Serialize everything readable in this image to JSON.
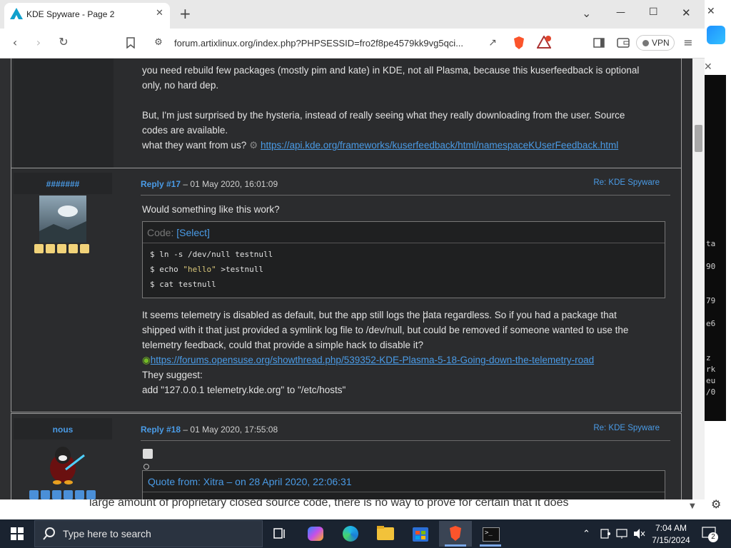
{
  "browser": {
    "tab_title": "KDE Spyware - Page 2",
    "new_tab": "+",
    "url": "forum.artixlinux.org/index.php?PHPSESSID=fro2f8pe4579kk9vg5qci...",
    "vpn_label": "VPN",
    "window_controls": {
      "dropdown": "⌄",
      "minimize": "—",
      "maximize": "☐",
      "close": "✕"
    }
  },
  "prev_post": {
    "line1": "you need rebuild few packages (mostly pim and kate) in KDE, not all Plasma, because this kuserfeedback is optional",
    "line2": "only, no hard dep.",
    "line3": "But, I'm just surprised by the hysteria, instead of really seeing what they really downloading from the user. Source",
    "line4": "codes are available.",
    "line5_prefix": "what they want from us?",
    "line5_link": "https://api.kde.org/frameworks/kuserfeedback/html/namespaceKUserFeedback.html"
  },
  "post17": {
    "username": "#######",
    "reply_label": "Reply #17",
    "reply_date": " – 01 May 2020, 16:01:09",
    "re_link": "Re: KDE Spyware",
    "intro": "Would something like this work?",
    "code_label": "Code:",
    "code_select": "[Select]",
    "code_lines": [
      {
        "pre": "$ ln -s /dev/null testnull",
        "str": "",
        "post": ""
      },
      {
        "pre": "$ echo ",
        "str": "\"hello\"",
        "post": " >testnull"
      },
      {
        "pre": "$ cat testnull",
        "str": "",
        "post": ""
      }
    ],
    "body1": "It seems telemetry is disabled as default, but the app still logs the data regardless. So if you had a package that",
    "body2": "shipped with it that just provided a symlink log file to /dev/null, but could be removed if someone wanted to use the",
    "body3": "telemetry feedback, could that provide a simple hack to disable it?",
    "link": "https://forums.opensuse.org/showthread.php/539352-KDE-Plasma-5-18-Going-down-the-telemetry-road",
    "body4": "They suggest:",
    "body5": "add \"127.0.0.1 telemetry.kde.org\" to \"/etc/hosts\""
  },
  "post18": {
    "username": "nous",
    "reply_label": "Reply #18",
    "reply_date": " – 01 May 2020, 17:55:08",
    "re_link": "Re: KDE Spyware",
    "quote_header": "Quote from: Xitra – on 28 April 2020, 22:06:31",
    "stub": "re"
  },
  "background_text": "large amount of proprietary closed source code, there is no way to prove for certain that it does",
  "taskbar": {
    "search_placeholder": "Type here to search",
    "time": "7:04 AM",
    "date": "7/15/2024",
    "notifications": "2"
  },
  "colors": {
    "accent_link": "#4a9be6",
    "forum_bg": "#2e2f31",
    "taskbar_bg": "#1a2330",
    "brave_orange": "#fb542b"
  }
}
